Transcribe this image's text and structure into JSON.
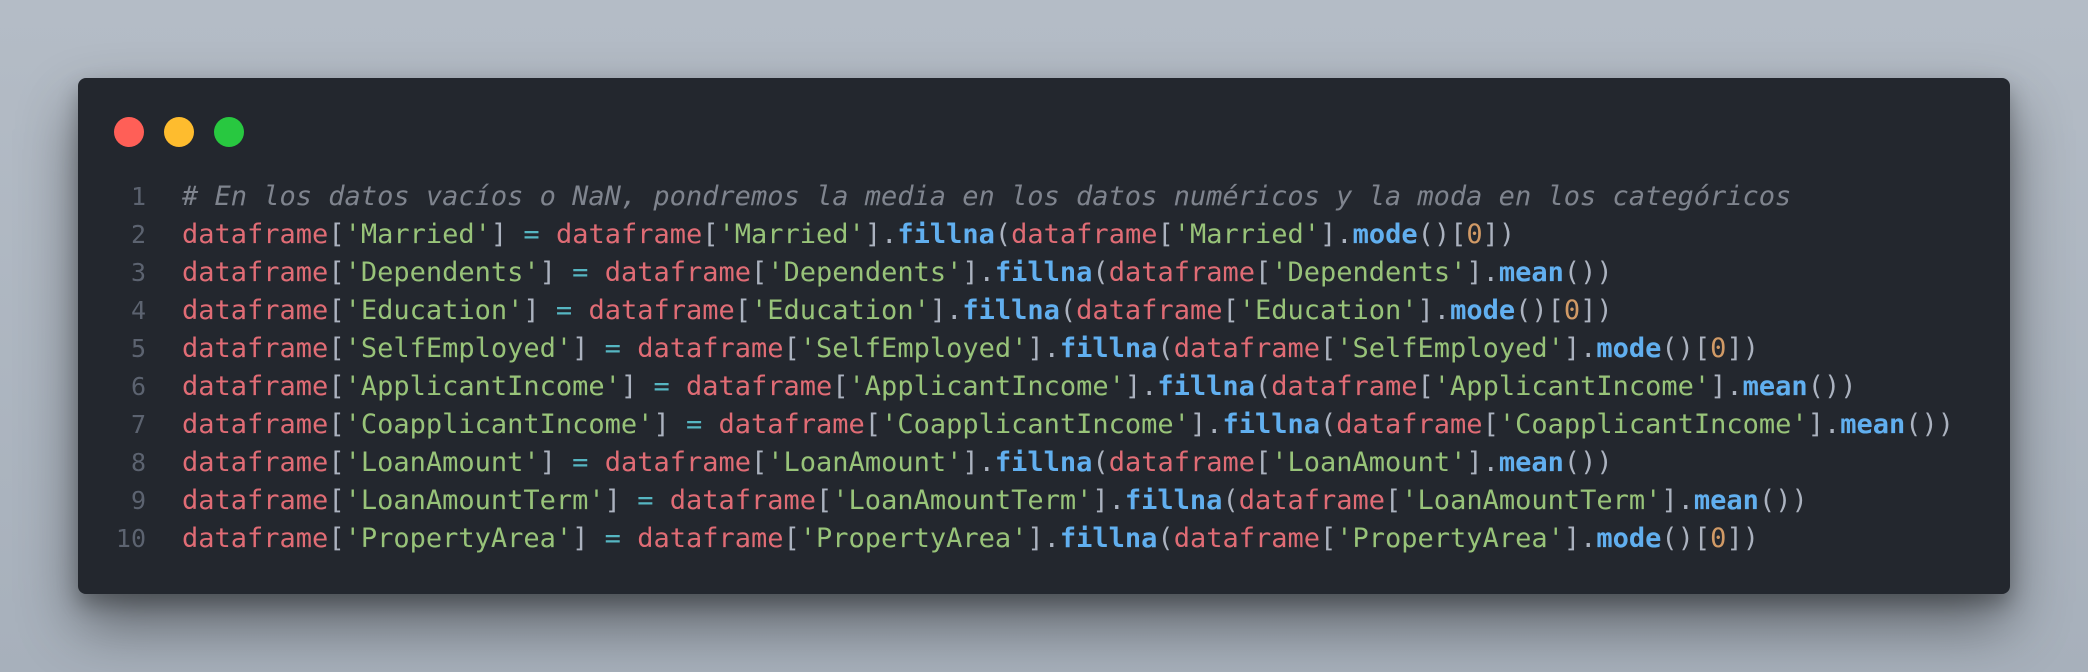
{
  "window": {
    "controls": [
      "close",
      "minimize",
      "maximize"
    ],
    "theme": {
      "background": "#23272e",
      "comment": "#7f848e",
      "variable": "#e06c75",
      "string": "#98c379",
      "operator": "#56b6c2",
      "function": "#61afef",
      "number": "#d19a66",
      "punctuation": "#abb2bf",
      "line_number": "#5c6370"
    }
  },
  "code": {
    "lines": [
      {
        "n": "1",
        "tokens": [
          {
            "t": "comment",
            "v": "# En los datos vacíos o NaN, pondremos la media en los datos numéricos y la moda en los categóricos"
          }
        ]
      },
      {
        "n": "2",
        "tokens": [
          {
            "t": "var",
            "v": "dataframe"
          },
          {
            "t": "punc",
            "v": "["
          },
          {
            "t": "str",
            "v": "'Married'"
          },
          {
            "t": "punc",
            "v": "]"
          },
          {
            "t": "op",
            "v": " = "
          },
          {
            "t": "var",
            "v": "dataframe"
          },
          {
            "t": "punc",
            "v": "["
          },
          {
            "t": "str",
            "v": "'Married'"
          },
          {
            "t": "punc",
            "v": "]."
          },
          {
            "t": "fn",
            "v": "fillna"
          },
          {
            "t": "punc",
            "v": "("
          },
          {
            "t": "var",
            "v": "dataframe"
          },
          {
            "t": "punc",
            "v": "["
          },
          {
            "t": "str",
            "v": "'Married'"
          },
          {
            "t": "punc",
            "v": "]."
          },
          {
            "t": "fn",
            "v": "mode"
          },
          {
            "t": "punc",
            "v": "()["
          },
          {
            "t": "num",
            "v": "0"
          },
          {
            "t": "punc",
            "v": "])"
          }
        ]
      },
      {
        "n": "3",
        "tokens": [
          {
            "t": "var",
            "v": "dataframe"
          },
          {
            "t": "punc",
            "v": "["
          },
          {
            "t": "str",
            "v": "'Dependents'"
          },
          {
            "t": "punc",
            "v": "]"
          },
          {
            "t": "op",
            "v": " = "
          },
          {
            "t": "var",
            "v": "dataframe"
          },
          {
            "t": "punc",
            "v": "["
          },
          {
            "t": "str",
            "v": "'Dependents'"
          },
          {
            "t": "punc",
            "v": "]."
          },
          {
            "t": "fn",
            "v": "fillna"
          },
          {
            "t": "punc",
            "v": "("
          },
          {
            "t": "var",
            "v": "dataframe"
          },
          {
            "t": "punc",
            "v": "["
          },
          {
            "t": "str",
            "v": "'Dependents'"
          },
          {
            "t": "punc",
            "v": "]."
          },
          {
            "t": "fn",
            "v": "mean"
          },
          {
            "t": "punc",
            "v": "())"
          }
        ]
      },
      {
        "n": "4",
        "tokens": [
          {
            "t": "var",
            "v": "dataframe"
          },
          {
            "t": "punc",
            "v": "["
          },
          {
            "t": "str",
            "v": "'Education'"
          },
          {
            "t": "punc",
            "v": "]"
          },
          {
            "t": "op",
            "v": " = "
          },
          {
            "t": "var",
            "v": "dataframe"
          },
          {
            "t": "punc",
            "v": "["
          },
          {
            "t": "str",
            "v": "'Education'"
          },
          {
            "t": "punc",
            "v": "]."
          },
          {
            "t": "fn",
            "v": "fillna"
          },
          {
            "t": "punc",
            "v": "("
          },
          {
            "t": "var",
            "v": "dataframe"
          },
          {
            "t": "punc",
            "v": "["
          },
          {
            "t": "str",
            "v": "'Education'"
          },
          {
            "t": "punc",
            "v": "]."
          },
          {
            "t": "fn",
            "v": "mode"
          },
          {
            "t": "punc",
            "v": "()["
          },
          {
            "t": "num",
            "v": "0"
          },
          {
            "t": "punc",
            "v": "])"
          }
        ]
      },
      {
        "n": "5",
        "tokens": [
          {
            "t": "var",
            "v": "dataframe"
          },
          {
            "t": "punc",
            "v": "["
          },
          {
            "t": "str",
            "v": "'SelfEmployed'"
          },
          {
            "t": "punc",
            "v": "]"
          },
          {
            "t": "op",
            "v": " = "
          },
          {
            "t": "var",
            "v": "dataframe"
          },
          {
            "t": "punc",
            "v": "["
          },
          {
            "t": "str",
            "v": "'SelfEmployed'"
          },
          {
            "t": "punc",
            "v": "]."
          },
          {
            "t": "fn",
            "v": "fillna"
          },
          {
            "t": "punc",
            "v": "("
          },
          {
            "t": "var",
            "v": "dataframe"
          },
          {
            "t": "punc",
            "v": "["
          },
          {
            "t": "str",
            "v": "'SelfEmployed'"
          },
          {
            "t": "punc",
            "v": "]."
          },
          {
            "t": "fn",
            "v": "mode"
          },
          {
            "t": "punc",
            "v": "()["
          },
          {
            "t": "num",
            "v": "0"
          },
          {
            "t": "punc",
            "v": "])"
          }
        ]
      },
      {
        "n": "6",
        "tokens": [
          {
            "t": "var",
            "v": "dataframe"
          },
          {
            "t": "punc",
            "v": "["
          },
          {
            "t": "str",
            "v": "'ApplicantIncome'"
          },
          {
            "t": "punc",
            "v": "]"
          },
          {
            "t": "op",
            "v": " = "
          },
          {
            "t": "var",
            "v": "dataframe"
          },
          {
            "t": "punc",
            "v": "["
          },
          {
            "t": "str",
            "v": "'ApplicantIncome'"
          },
          {
            "t": "punc",
            "v": "]."
          },
          {
            "t": "fn",
            "v": "fillna"
          },
          {
            "t": "punc",
            "v": "("
          },
          {
            "t": "var",
            "v": "dataframe"
          },
          {
            "t": "punc",
            "v": "["
          },
          {
            "t": "str",
            "v": "'ApplicantIncome'"
          },
          {
            "t": "punc",
            "v": "]."
          },
          {
            "t": "fn",
            "v": "mean"
          },
          {
            "t": "punc",
            "v": "())"
          }
        ]
      },
      {
        "n": "7",
        "tokens": [
          {
            "t": "var",
            "v": "dataframe"
          },
          {
            "t": "punc",
            "v": "["
          },
          {
            "t": "str",
            "v": "'CoapplicantIncome'"
          },
          {
            "t": "punc",
            "v": "]"
          },
          {
            "t": "op",
            "v": " = "
          },
          {
            "t": "var",
            "v": "dataframe"
          },
          {
            "t": "punc",
            "v": "["
          },
          {
            "t": "str",
            "v": "'CoapplicantIncome'"
          },
          {
            "t": "punc",
            "v": "]."
          },
          {
            "t": "fn",
            "v": "fillna"
          },
          {
            "t": "punc",
            "v": "("
          },
          {
            "t": "var",
            "v": "dataframe"
          },
          {
            "t": "punc",
            "v": "["
          },
          {
            "t": "str",
            "v": "'CoapplicantIncome'"
          },
          {
            "t": "punc",
            "v": "]."
          },
          {
            "t": "fn",
            "v": "mean"
          },
          {
            "t": "punc",
            "v": "())"
          }
        ]
      },
      {
        "n": "8",
        "tokens": [
          {
            "t": "var",
            "v": "dataframe"
          },
          {
            "t": "punc",
            "v": "["
          },
          {
            "t": "str",
            "v": "'LoanAmount'"
          },
          {
            "t": "punc",
            "v": "]"
          },
          {
            "t": "op",
            "v": " = "
          },
          {
            "t": "var",
            "v": "dataframe"
          },
          {
            "t": "punc",
            "v": "["
          },
          {
            "t": "str",
            "v": "'LoanAmount'"
          },
          {
            "t": "punc",
            "v": "]."
          },
          {
            "t": "fn",
            "v": "fillna"
          },
          {
            "t": "punc",
            "v": "("
          },
          {
            "t": "var",
            "v": "dataframe"
          },
          {
            "t": "punc",
            "v": "["
          },
          {
            "t": "str",
            "v": "'LoanAmount'"
          },
          {
            "t": "punc",
            "v": "]."
          },
          {
            "t": "fn",
            "v": "mean"
          },
          {
            "t": "punc",
            "v": "())"
          }
        ]
      },
      {
        "n": "9",
        "tokens": [
          {
            "t": "var",
            "v": "dataframe"
          },
          {
            "t": "punc",
            "v": "["
          },
          {
            "t": "str",
            "v": "'LoanAmountTerm'"
          },
          {
            "t": "punc",
            "v": "]"
          },
          {
            "t": "op",
            "v": " = "
          },
          {
            "t": "var",
            "v": "dataframe"
          },
          {
            "t": "punc",
            "v": "["
          },
          {
            "t": "str",
            "v": "'LoanAmountTerm'"
          },
          {
            "t": "punc",
            "v": "]."
          },
          {
            "t": "fn",
            "v": "fillna"
          },
          {
            "t": "punc",
            "v": "("
          },
          {
            "t": "var",
            "v": "dataframe"
          },
          {
            "t": "punc",
            "v": "["
          },
          {
            "t": "str",
            "v": "'LoanAmountTerm'"
          },
          {
            "t": "punc",
            "v": "]."
          },
          {
            "t": "fn",
            "v": "mean"
          },
          {
            "t": "punc",
            "v": "())"
          }
        ]
      },
      {
        "n": "10",
        "tokens": [
          {
            "t": "var",
            "v": "dataframe"
          },
          {
            "t": "punc",
            "v": "["
          },
          {
            "t": "str",
            "v": "'PropertyArea'"
          },
          {
            "t": "punc",
            "v": "]"
          },
          {
            "t": "op",
            "v": " = "
          },
          {
            "t": "var",
            "v": "dataframe"
          },
          {
            "t": "punc",
            "v": "["
          },
          {
            "t": "str",
            "v": "'PropertyArea'"
          },
          {
            "t": "punc",
            "v": "]."
          },
          {
            "t": "fn",
            "v": "fillna"
          },
          {
            "t": "punc",
            "v": "("
          },
          {
            "t": "var",
            "v": "dataframe"
          },
          {
            "t": "punc",
            "v": "["
          },
          {
            "t": "str",
            "v": "'PropertyArea'"
          },
          {
            "t": "punc",
            "v": "]."
          },
          {
            "t": "fn",
            "v": "mode"
          },
          {
            "t": "punc",
            "v": "()["
          },
          {
            "t": "num",
            "v": "0"
          },
          {
            "t": "punc",
            "v": "])"
          }
        ]
      }
    ]
  }
}
